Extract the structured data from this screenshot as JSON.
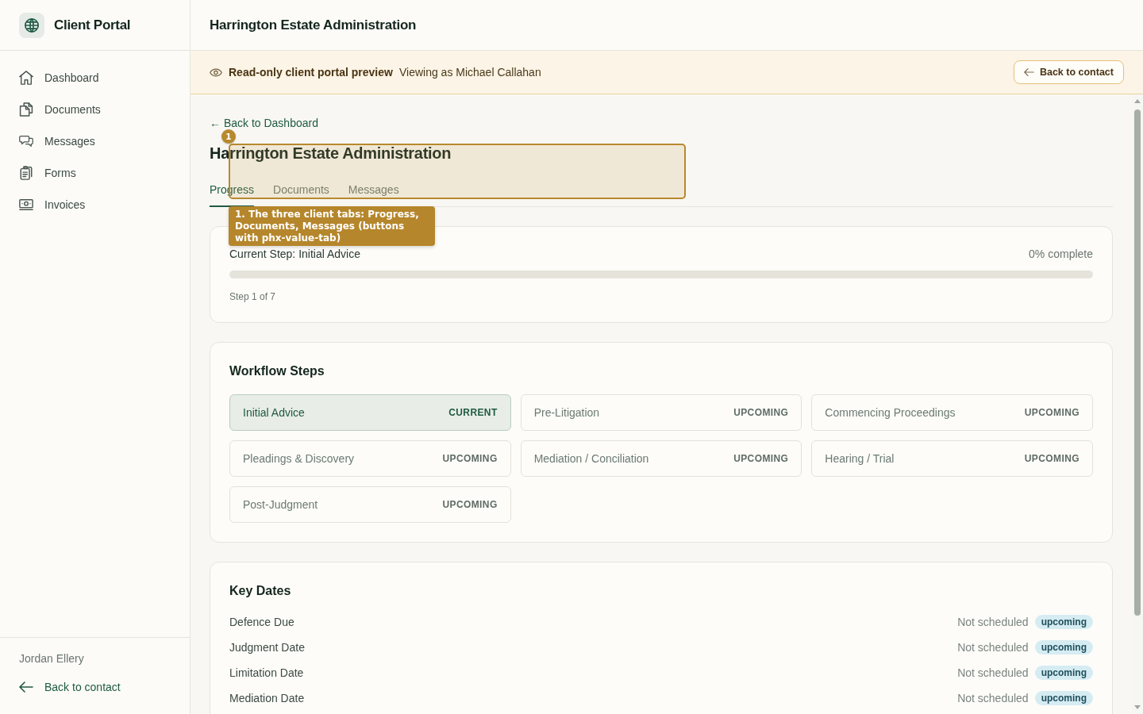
{
  "sidebar": {
    "brand": "Client Portal",
    "items": [
      {
        "label": "Dashboard"
      },
      {
        "label": "Documents"
      },
      {
        "label": "Messages"
      },
      {
        "label": "Forms"
      },
      {
        "label": "Invoices"
      }
    ],
    "user": "Jordan Ellery",
    "back_link": "Back to contact"
  },
  "header": {
    "title": "Harrington Estate Administration"
  },
  "banner": {
    "title": "Read-only client portal preview",
    "subtitle": "Viewing as Michael Callahan",
    "button": "Back to contact"
  },
  "page": {
    "back_link": "← Back to Dashboard",
    "title": "Harrington Estate Administration",
    "tabs": [
      {
        "label": "Progress",
        "selected": true
      },
      {
        "label": "Documents",
        "selected": false
      },
      {
        "label": "Messages",
        "selected": false
      }
    ]
  },
  "progress": {
    "current_step": "Current Step: Initial Advice",
    "percent": "0% complete",
    "level": 0,
    "step_count": "Step 1 of 7"
  },
  "workflow": {
    "title": "Workflow Steps",
    "steps": [
      {
        "name": "Initial Advice",
        "status": "CURRENT",
        "current": true
      },
      {
        "name": "Pre-Litigation",
        "status": "UPCOMING",
        "current": false
      },
      {
        "name": "Commencing Proceedings",
        "status": "UPCOMING",
        "current": false
      },
      {
        "name": "Pleadings & Discovery",
        "status": "UPCOMING",
        "current": false
      },
      {
        "name": "Mediation / Conciliation",
        "status": "UPCOMING",
        "current": false
      },
      {
        "name": "Hearing / Trial",
        "status": "UPCOMING",
        "current": false
      },
      {
        "name": "Post-Judgment",
        "status": "UPCOMING",
        "current": false
      }
    ]
  },
  "key_dates": {
    "title": "Key Dates",
    "rows": [
      {
        "label": "Defence Due",
        "value": "Not scheduled",
        "badge": "upcoming"
      },
      {
        "label": "Judgment Date",
        "value": "Not scheduled",
        "badge": "upcoming"
      },
      {
        "label": "Limitation Date",
        "value": "Not scheduled",
        "badge": "upcoming"
      },
      {
        "label": "Mediation Date",
        "value": "Not scheduled",
        "badge": "upcoming"
      }
    ]
  },
  "annotation": {
    "number": "1",
    "text": "1. The three client tabs: Progress, Documents, Messages (buttons with phx-value-tab)"
  }
}
